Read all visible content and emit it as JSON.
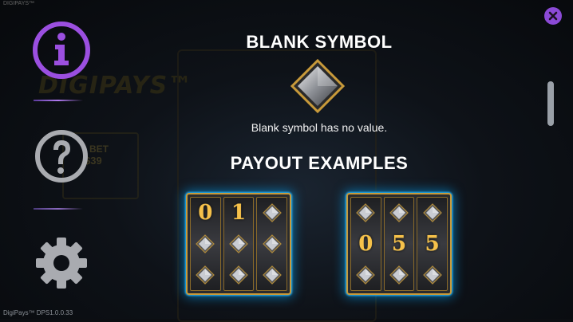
{
  "app": {
    "top_tag": "DIGIPAYS™",
    "version": "DigiPays™ DPS1.0.0.33"
  },
  "background": {
    "logo": "DIGIPAYS™",
    "bet_label": "BET",
    "bet_value": "$39"
  },
  "menu": {
    "info": {
      "icon": "info-icon",
      "color": "#9b4fe0"
    },
    "help": {
      "icon": "help-icon",
      "color": "#a9abb0"
    },
    "settings": {
      "icon": "gear-icon",
      "color": "#a9abb0"
    }
  },
  "close": {
    "icon": "close-icon",
    "color": "#8b4ad6"
  },
  "content": {
    "blank_title": "BLANK SYMBOL",
    "blank_description": "Blank symbol has no value.",
    "payout_title": "PAYOUT EXAMPLES"
  },
  "examples": [
    {
      "reels": [
        [
          "0",
          "blank",
          "blank"
        ],
        [
          "1",
          "blank",
          "blank"
        ],
        [
          "blank",
          "blank",
          "blank"
        ]
      ]
    },
    {
      "reels": [
        [
          "blank",
          "0",
          "blank"
        ],
        [
          "blank",
          "5",
          "blank"
        ],
        [
          "blank",
          "5",
          "blank"
        ]
      ]
    }
  ],
  "colors": {
    "accent": "#9b4fe0",
    "digit": "#f6c14a",
    "panel_glow": "#3ac0ff",
    "panel_border": "#c89a3a"
  }
}
